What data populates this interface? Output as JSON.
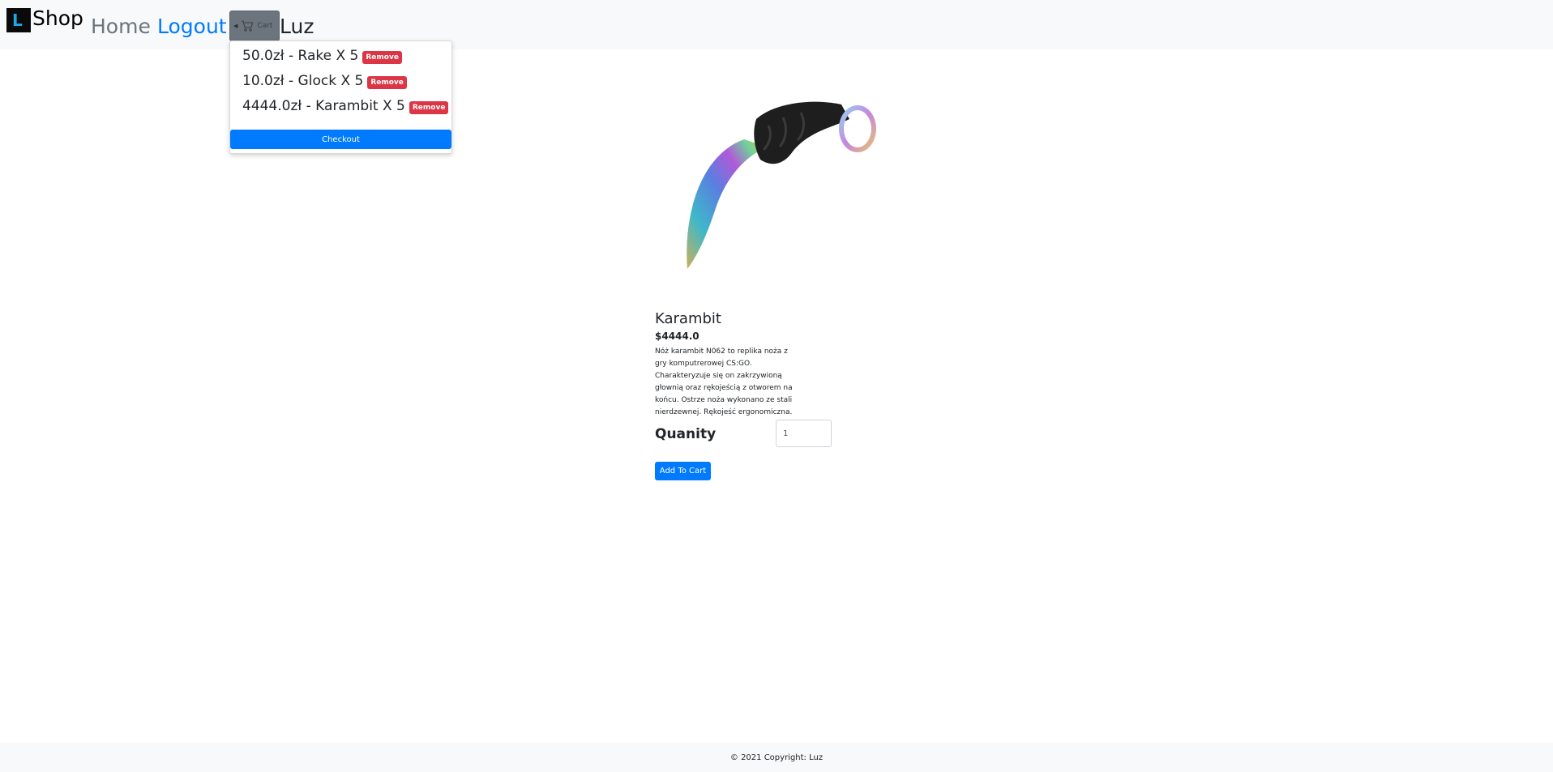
{
  "navbar": {
    "logo_letter": "L",
    "brand": "Shop",
    "home": "Home",
    "logout": "Logout",
    "cart_label": "Cart",
    "user": "Luz"
  },
  "cart_dropdown": {
    "items": [
      {
        "text": "50.0zł - Rake X 5",
        "remove_label": "Remove"
      },
      {
        "text": "10.0zł - Glock X 5",
        "remove_label": "Remove"
      },
      {
        "text": "4444.0zł - Karambit X 5",
        "remove_label": "Remove"
      }
    ],
    "checkout_label": "Checkout"
  },
  "product": {
    "name": "Karambit",
    "price": "$4444.0",
    "description": "Nóż karambit N062 to replika noża z gry komputrerowej CS:GO. Charakteryzuje się on zakrzywioną głownią oraz rękojeścią z otworem na końcu. Ostrze noża wykonano ze stali nierdzewnej. Rękojeść ergonomiczna.",
    "quantity_label": "Quanity",
    "quantity_value": "1",
    "add_to_cart_label": "Add To Cart"
  },
  "footer": {
    "copyright": "© 2021 Copyright: Luz"
  },
  "colors": {
    "primary": "#007bff",
    "danger": "#dc3545",
    "secondary": "#6c757d",
    "navbar_bg": "#f8f9fa"
  },
  "icons": [
    "shop-logo-icon",
    "cart-icon",
    "caret-left-icon"
  ]
}
